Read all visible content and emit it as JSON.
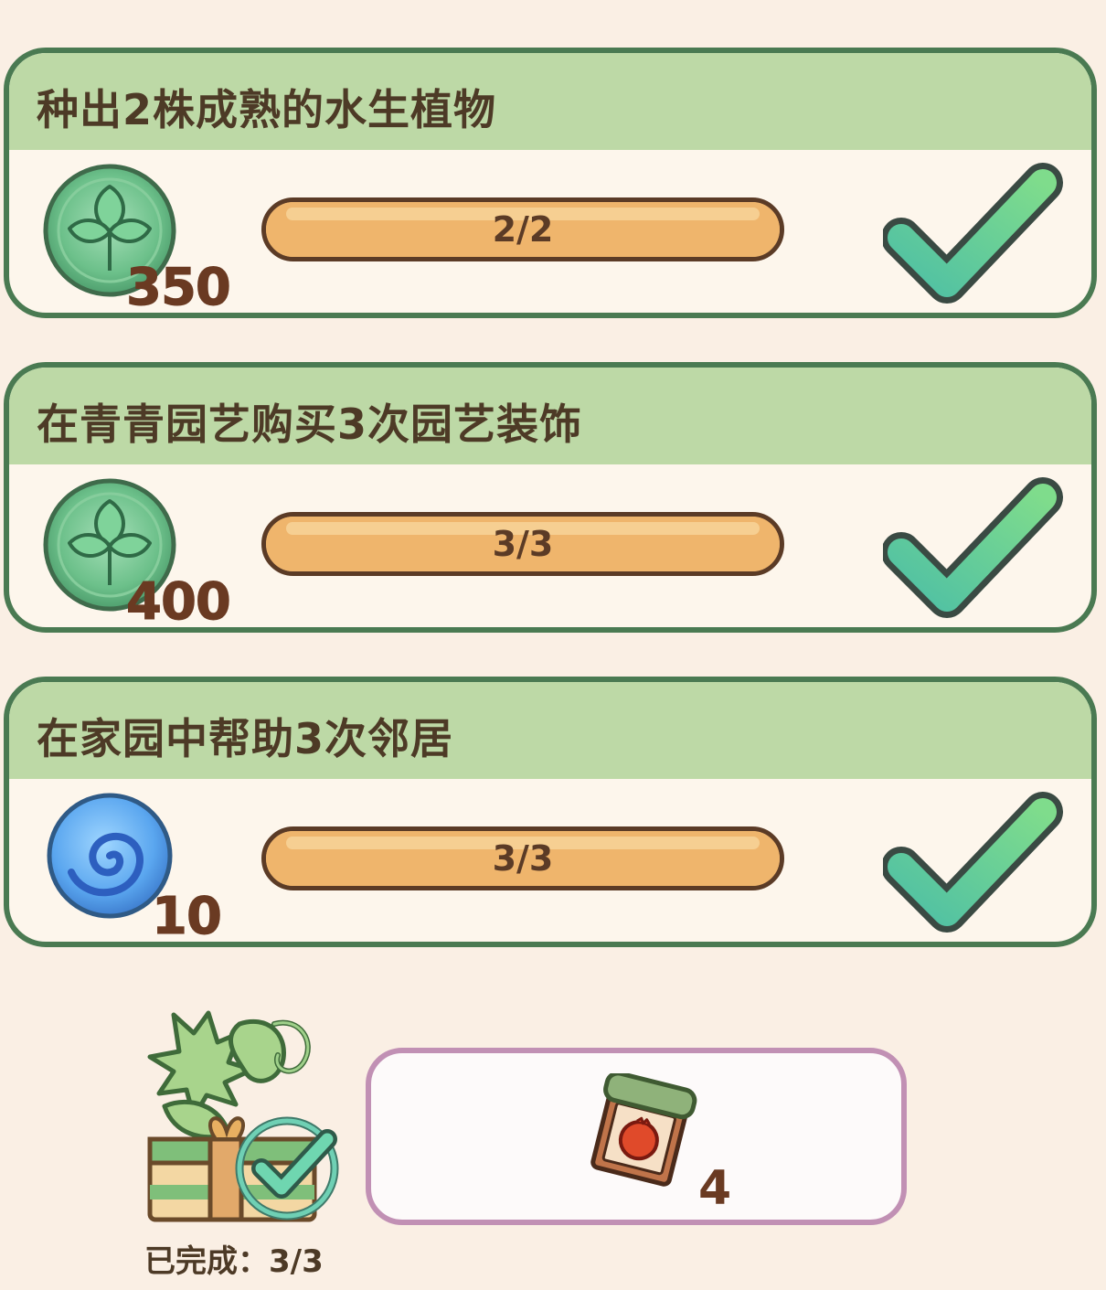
{
  "tasks": [
    {
      "title": "种出2株成熟的水生植物",
      "reward_icon": "leaf-coin-icon",
      "reward_count": "350",
      "progress_text": "2/2",
      "progress_fraction": 1.0,
      "completed": true
    },
    {
      "title": "在青青园艺购买3次园艺装饰",
      "reward_icon": "leaf-coin-icon",
      "reward_count": "400",
      "progress_text": "3/3",
      "progress_fraction": 1.0,
      "completed": true
    },
    {
      "title": "在家园中帮助3次邻居",
      "reward_icon": "blue-swirl-orb-icon",
      "reward_count": "10",
      "progress_text": "3/3",
      "progress_fraction": 1.0,
      "completed": true
    }
  ],
  "summary": {
    "chest_icon": "plant-gift-chest-icon",
    "completed_label": "已完成：3/3",
    "reward_item_icon": "pomegranate-seed-packet-icon",
    "reward_item_count": "4"
  },
  "colors": {
    "background": "#faefe4",
    "card_border": "#4a7a52",
    "card_header": "#bdd9a6",
    "card_body": "#fdf6ec",
    "progress_fill": "#efb56c",
    "check_green": "#5fcf95",
    "text_brown": "#4d3a26",
    "reward_box_border": "#c190b4"
  }
}
